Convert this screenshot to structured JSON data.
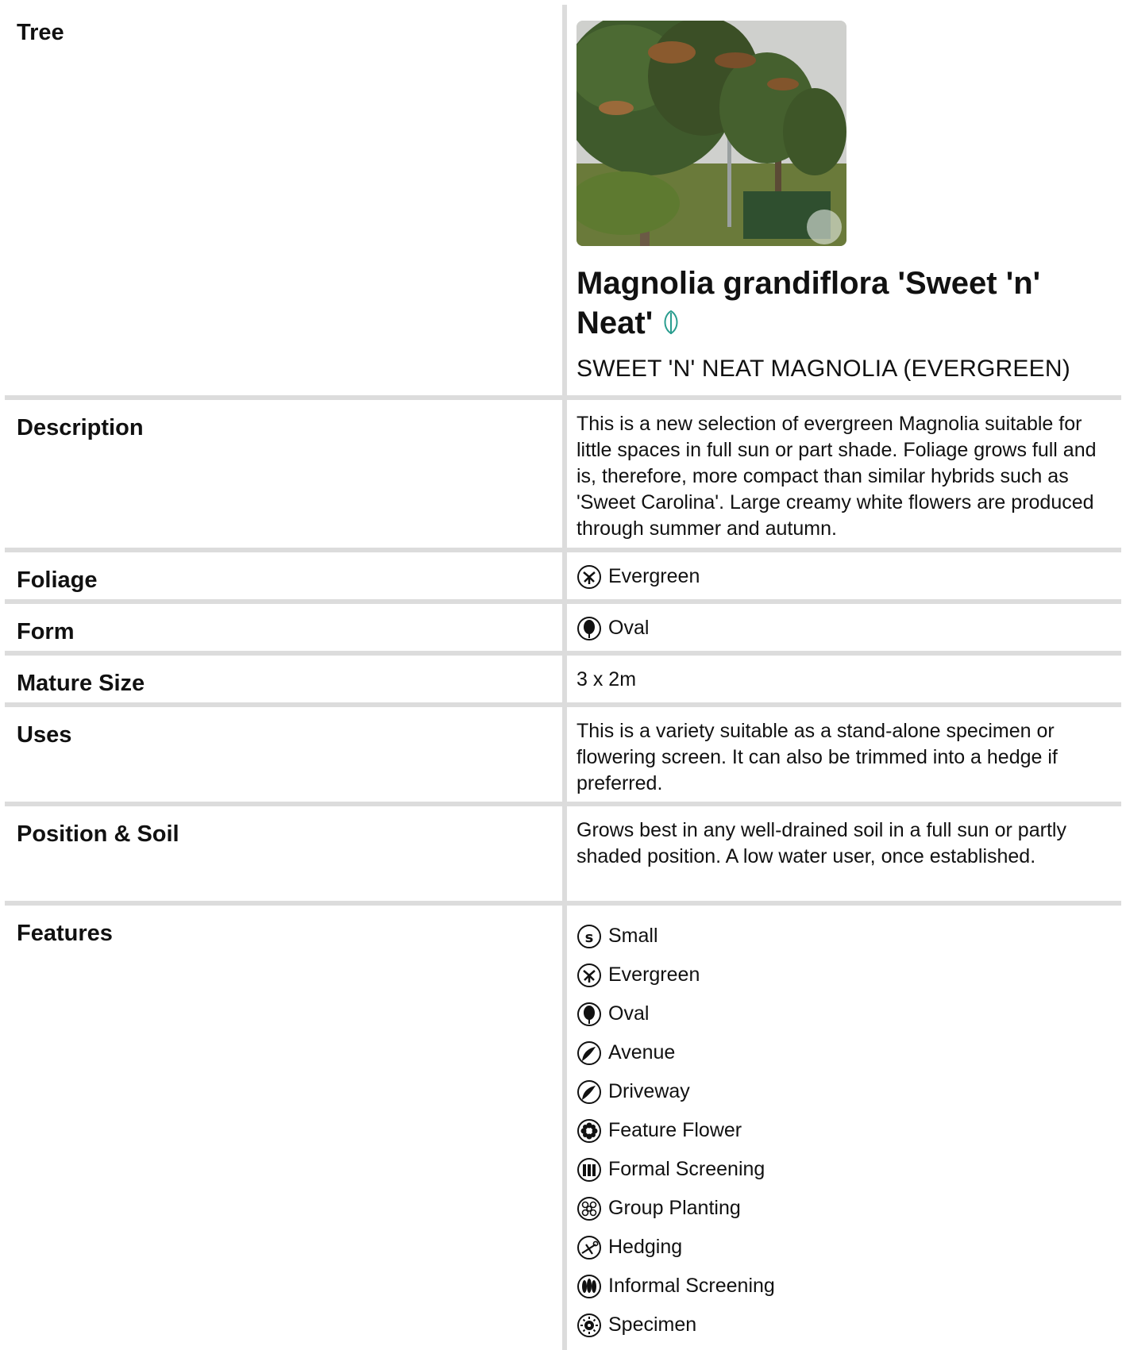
{
  "rows": {
    "tree": {
      "label": "Tree",
      "plant_name": "Magnolia grandiflora 'Sweet 'n' Neat'",
      "common_name": "SWEET 'N' NEAT MAGNOLIA (EVERGREEN)"
    },
    "description": {
      "label": "Description",
      "text": "This is a new selection of evergreen Magnolia suitable for little spaces in full sun or part shade. Foliage grows full and is, therefore, more compact than similar hybrids such as 'Sweet Carolina'. Large creamy white flowers are produced through summer and autumn."
    },
    "foliage": {
      "label": "Foliage",
      "value": "Evergreen",
      "icon": "evergreen-icon"
    },
    "form": {
      "label": "Form",
      "value": "Oval",
      "icon": "oval-icon"
    },
    "mature_size": {
      "label": "Mature Size",
      "value": "3 x 2m"
    },
    "uses": {
      "label": "Uses",
      "text": "This is a variety suitable as a stand-alone specimen or flowering screen. It can also be trimmed into a hedge if preferred."
    },
    "position_soil": {
      "label": "Position & Soil",
      "text": "Grows best in any well-drained soil in a full sun or partly shaded position. A low water user, once established."
    },
    "features": {
      "label": "Features",
      "items": [
        {
          "label": "Small",
          "icon": "small-icon"
        },
        {
          "label": "Evergreen",
          "icon": "evergreen-icon"
        },
        {
          "label": "Oval",
          "icon": "oval-icon"
        },
        {
          "label": "Avenue",
          "icon": "avenue-icon"
        },
        {
          "label": "Driveway",
          "icon": "driveway-icon"
        },
        {
          "label": "Feature Flower",
          "icon": "feature-flower-icon"
        },
        {
          "label": "Formal Screening",
          "icon": "formal-screening-icon"
        },
        {
          "label": "Group Planting",
          "icon": "group-planting-icon"
        },
        {
          "label": "Hedging",
          "icon": "hedging-icon"
        },
        {
          "label": "Informal Screening",
          "icon": "informal-screening-icon"
        },
        {
          "label": "Specimen",
          "icon": "specimen-icon"
        }
      ]
    }
  },
  "colors": {
    "grid_line": "#dcdcdc",
    "leaf_accent": "#2a9d8f"
  }
}
